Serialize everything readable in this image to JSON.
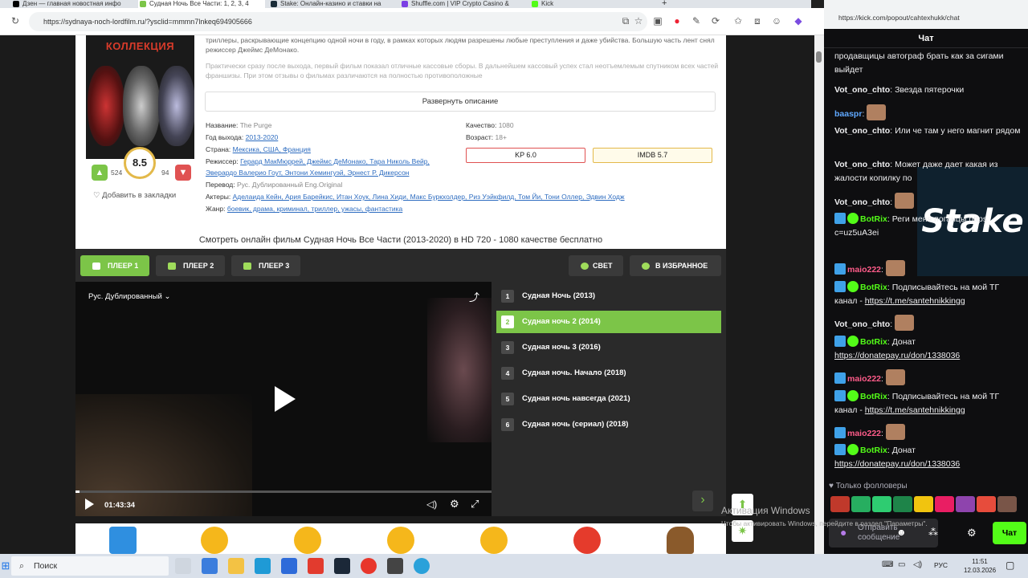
{
  "browser": {
    "tabs": [
      {
        "label": "Дзен — главная новостная инфо",
        "color": "#000000"
      },
      {
        "label": "Судная Ночь Все Части: 1, 2, 3, 4",
        "color": "#7cc548"
      },
      {
        "label": "Stake: Онлайн-казино и ставки на",
        "color": "#1a2c38"
      },
      {
        "label": "Shuffle.com | VIP Crypto Casino &",
        "color": "#7b3fe4"
      },
      {
        "label": "Kick",
        "color": "#53fc18"
      }
    ],
    "url": "https://sydnaya-noch-lordfilm.ru/?ysclid=mmmn7lnkeq694905666",
    "chat_url": "https://kick.com/popout/cahtexhukk/chat"
  },
  "movie": {
    "poster_title": "КОЛЛЕКЦИЯ",
    "rating": "8.5",
    "likes": "524",
    "dislikes": "94",
    "bookmark": "Добавить в закладки",
    "desc1": "триллеры, раскрывающие концепцию одной ночи в году, в рамках которых людям разрешены любые преступления и даже убийства. Большую часть лент снял режиссер Джеймс ДеМонако.",
    "desc2": "Практически сразу после выхода, первый фильм показал отличные кассовые сборы. В дальнейшем кассовый успех стал неотъемлемым спутником всех частей франшизы. При этом отзывы о фильмах различаются на полностью противоположные",
    "expand": "Развернуть описание",
    "name_label": "Название:",
    "name": "The Purge",
    "year_label": "Год выхода:",
    "year": "2013-2020",
    "country_label": "Страна:",
    "countries": "Мексика, США, Франция",
    "director_label": "Режиссер:",
    "directors": "Герард МакМюррей, Джеймс ДеМонако, Тара Николь Вейр,",
    "directors2": "Эверардо Валерио Гоут, Энтони Хемингуэй, Эрнест Р. Дикерсон",
    "translation_label": "Перевод:",
    "translation": "Рус. Дублированный Eng.Original",
    "actors_label": "Актеры:",
    "actors": "Аделаида Кейн, Ария Барейкис, Итан Хоук, Лина Хиди, Макс Буркхолдер, Риз Уэйкфилд, Том Йи, Тони Оллер, Эдвин Ходж",
    "genre_label": "Жанр:",
    "genres": "боевик, драма, криминал, триллер, ужасы, фантастика",
    "quality_label": "Качество:",
    "quality": "1080",
    "age_label": "Возраст:",
    "age": "18+",
    "kp": "KP 6.0",
    "imdb": "IMDB 5.7",
    "watch_title": "Смотреть онлайн фильм Судная Ночь Все Части (2013-2020) в HD 720 - 1080 качестве бесплатно"
  },
  "player": {
    "tabs": [
      "ПЛЕЕР 1",
      "ПЛЕЕР 2",
      "ПЛЕЕР 3"
    ],
    "light": "СВЕТ",
    "favorite": "В ИЗБРАННОЕ",
    "audio": "Рус. Дублированный",
    "time": "01:43:34",
    "progress": 0.01,
    "episodes": [
      {
        "n": "1",
        "title": "Судная Ночь (2013)"
      },
      {
        "n": "2",
        "title": "Судная ночь 2 (2014)"
      },
      {
        "n": "3",
        "title": "Судная ночь 3 (2016)"
      },
      {
        "n": "4",
        "title": "Судная ночь. Начало (2018)"
      },
      {
        "n": "5",
        "title": "Судная ночь навсегда (2021)"
      },
      {
        "n": "6",
        "title": "Судная ночь (сериал) (2018)"
      }
    ],
    "selected_episode": 1
  },
  "chat": {
    "header": "Чат",
    "messages": [
      {
        "user": "",
        "text": "продавщицы автограф брать как за сигами выйдет"
      },
      {
        "user": "Vot_ono_chto",
        "text": "Звезда пятерочки"
      },
      {
        "user": "baaspr",
        "text": ""
      },
      {
        "user": "Vot_ono_chto",
        "text": "Или че там у него магнит рядом"
      },
      {
        "user": "Vot_ono_chto",
        "text": "Может даже дает какая из жалости копилку по"
      },
      {
        "user": "Vot_ono_chto",
        "text": ""
      },
      {
        "user": "BotRix",
        "text": "Реги меня поганцы https",
        "extra": "c=uz5uA3ei"
      },
      {
        "user": "maio222",
        "text": ""
      },
      {
        "user": "BotRix",
        "text": "Подписывайтесь на мой ТГ канал - ",
        "link": "https://t.me/santehnikkingg"
      },
      {
        "user": "Vot_ono_chto",
        "text": ""
      },
      {
        "user": "BotRix",
        "text": "Донат ",
        "link": "https://donatepay.ru/don/1338036"
      },
      {
        "user": "maio222",
        "text": ""
      },
      {
        "user": "BotRix",
        "text": "Подписывайтесь на мой ТГ канал - ",
        "link": "https://t.me/santehnikkingg"
      },
      {
        "user": "maio222",
        "text": ""
      },
      {
        "user": "BotRix",
        "text": "Донат ",
        "link": "https://donatepay.ru/don/1338036"
      }
    ],
    "ad": "Stake",
    "followers_only": "Только фолловеры",
    "input_placeholder": "Отправить сообщение",
    "send": "Чат"
  },
  "windows": {
    "activation": "Активация Windows",
    "activation_sub": "Чтобы активировать Windows, перейдите в раздел \"Параметры\".",
    "search": "Поиск",
    "lang": "РУС",
    "time": "11:51",
    "date": "12.03.2026"
  },
  "colors": {
    "accent": "#7cc548",
    "kick": "#53fc18",
    "kp": "#e05252",
    "imdb": "#e3b94a"
  }
}
